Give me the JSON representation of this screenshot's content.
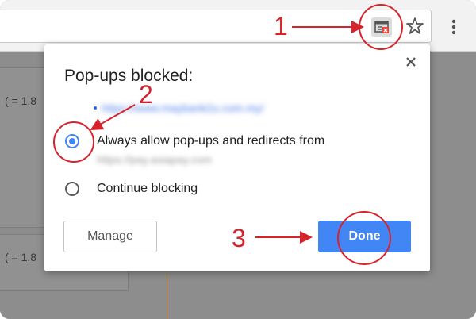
{
  "dialog": {
    "title": "Pop-ups blocked:",
    "blocked_link": "https://www.maybank2u.com.my/",
    "option_allow": {
      "label": "Always allow pop-ups and redirects from",
      "sublabel": "https://pay.asiapay.com",
      "checked": true
    },
    "option_block": {
      "label": "Continue blocking",
      "checked": false
    },
    "manage_label": "Manage",
    "done_label": "Done"
  },
  "background_page": {
    "snippet_1": "( = 1.8",
    "snippet_2": "( = 1.8"
  },
  "annotations": {
    "step_1": "1",
    "step_2": "2",
    "step_3": "3",
    "color": "#d6232c"
  },
  "colors": {
    "accent": "#4285f4",
    "toolbar_bg": "#f2f2f2",
    "overlay_bg": "#8d8d8d"
  },
  "icons": {
    "popup_blocked": "popup-blocked-icon",
    "bookmark": "star-icon",
    "menu": "kebab-menu-icon",
    "close": "close-icon"
  }
}
